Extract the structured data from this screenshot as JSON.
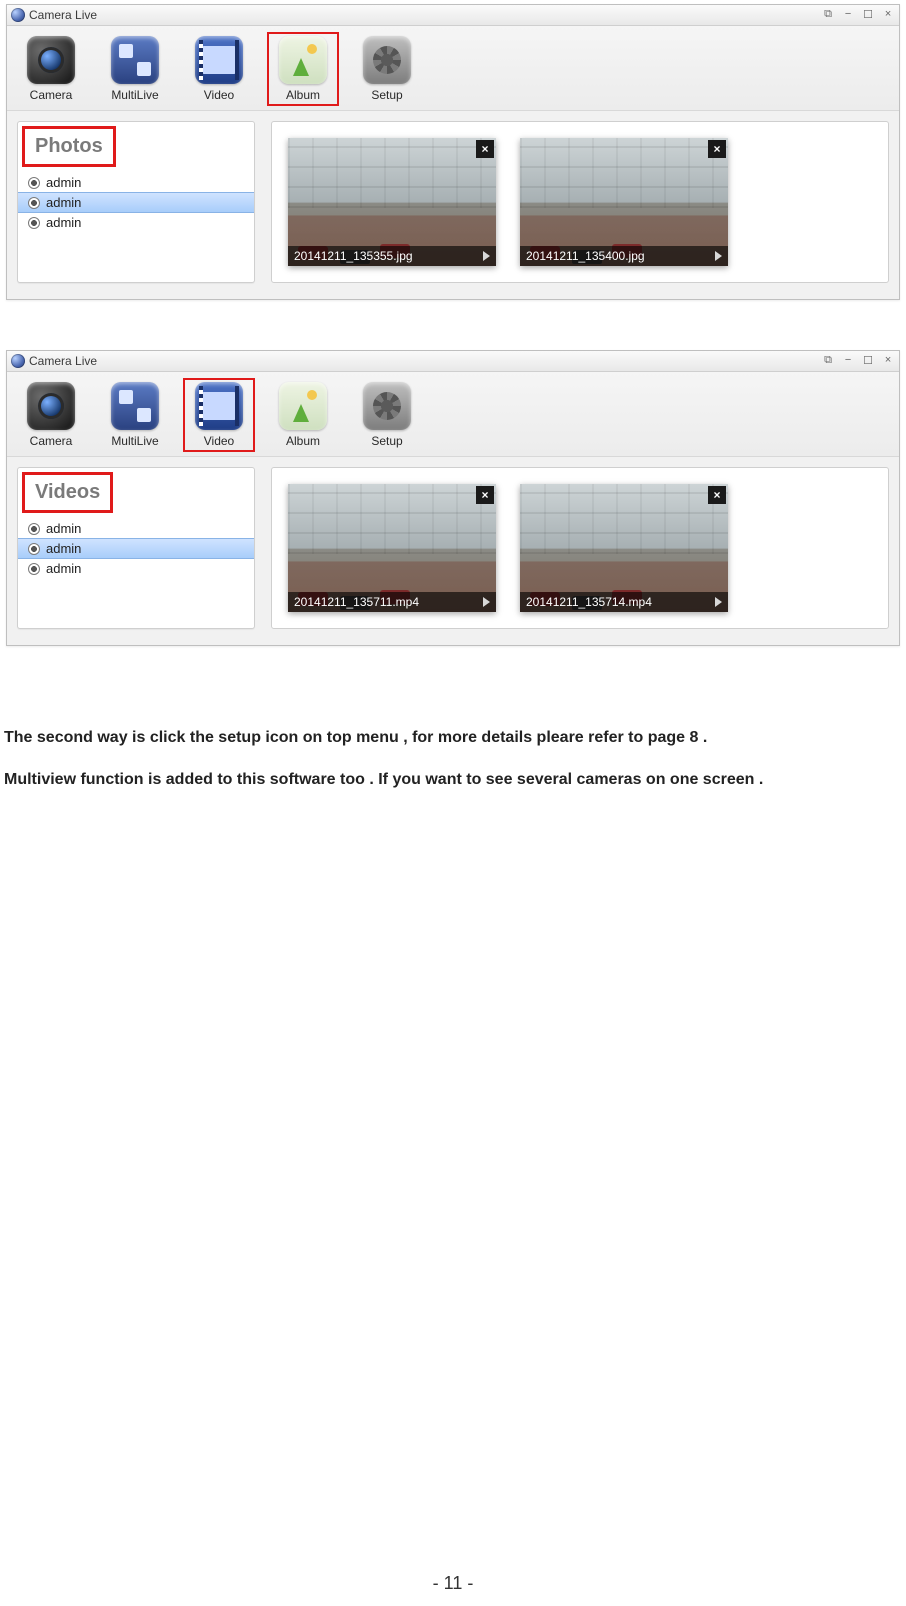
{
  "app_title": "Camera Live",
  "toolbar": {
    "camera": "Camera",
    "multilive": "MultiLive",
    "video": "Video",
    "album": "Album",
    "setup": "Setup"
  },
  "window1": {
    "panel_title": "Photos",
    "list": [
      "admin",
      "admin",
      "admin"
    ],
    "selected_index": 1,
    "thumbs": [
      {
        "file": "20141211_135355.jpg"
      },
      {
        "file": "20141211_135400.jpg"
      }
    ],
    "highlight_toolbar": "album",
    "highlight_panel": true
  },
  "window2": {
    "panel_title": "Videos",
    "list": [
      "admin",
      "admin",
      "admin"
    ],
    "selected_index": 1,
    "thumbs": [
      {
        "file": "20141211_135711.mp4"
      },
      {
        "file": "20141211_135714.mp4"
      }
    ],
    "highlight_toolbar": "video",
    "highlight_panel": true
  },
  "body_paragraphs": [
    "The second way is click the setup icon on top menu , for more details pleare refer to page 8 .",
    "Multiview function is added to this software too . If you want to see several cameras on one screen ."
  ],
  "page_number": "- 11 -",
  "close_glyph": "×"
}
